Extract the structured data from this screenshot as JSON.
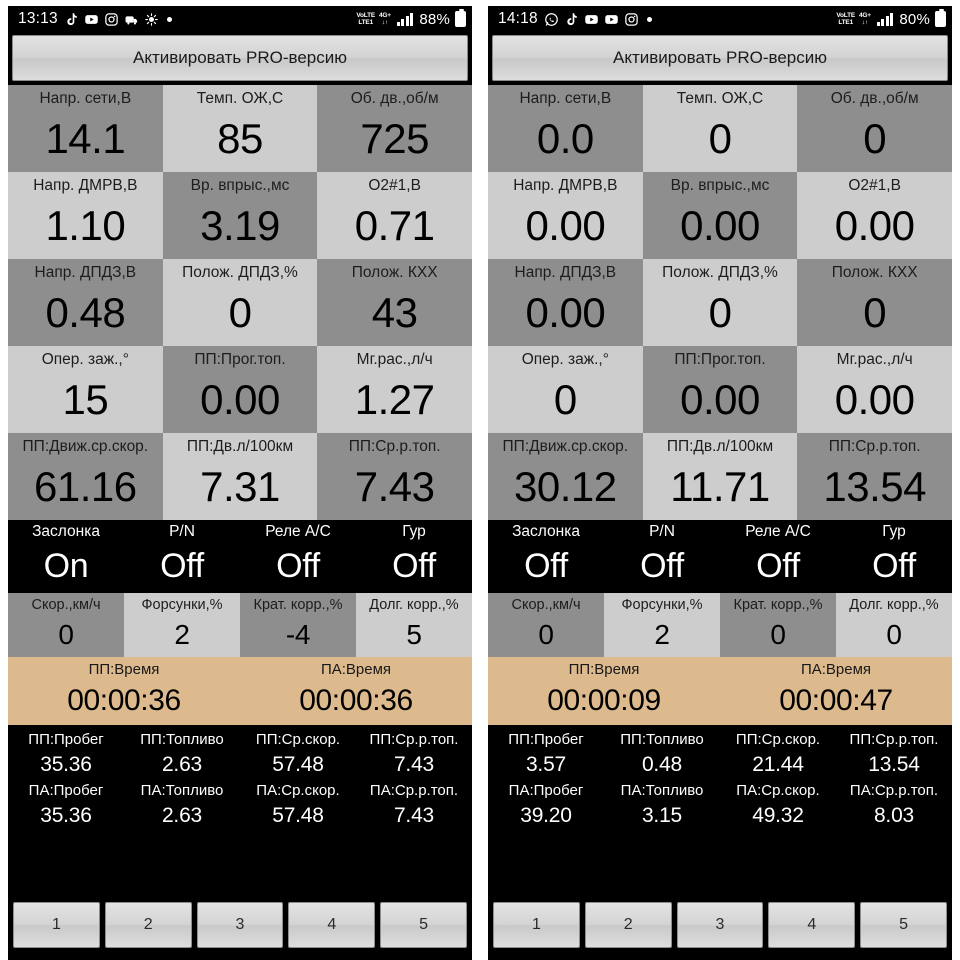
{
  "panels": [
    {
      "id": "left",
      "status": {
        "time": "13:13",
        "icons": [
          "tiktok-icon",
          "youtube-icon",
          "instagram-icon",
          "music-note-icon",
          "brightness-icon",
          "dot-icon"
        ],
        "volte_top": "VoLTE",
        "volte_bottom": "LTE1",
        "net_top": "4G+",
        "net_bottom": "↓↑",
        "battery": "88%"
      },
      "pro_button": "Активировать PRO-версию",
      "gauges": [
        {
          "label": "Напр. сети,В",
          "value": "14.1"
        },
        {
          "label": "Темп. ОЖ,С",
          "value": "85"
        },
        {
          "label": "Об. дв.,об/м",
          "value": "725"
        },
        {
          "label": "Напр. ДМРВ,В",
          "value": "1.10"
        },
        {
          "label": "Вр. впрыс.,мс",
          "value": "3.19"
        },
        {
          "label": "O2#1,В",
          "value": "0.71"
        },
        {
          "label": "Напр. ДПДЗ,В",
          "value": "0.48"
        },
        {
          "label": "Полож. ДПДЗ,%",
          "value": "0"
        },
        {
          "label": "Полож. КХХ",
          "value": "43"
        },
        {
          "label": "Опер. заж.,°",
          "value": "15"
        },
        {
          "label": "ПП:Прог.топ.",
          "value": "0.00"
        },
        {
          "label": "Мг.рас.,л/ч",
          "value": "1.27"
        },
        {
          "label": "ПП:Движ.ср.скор.",
          "value": "61.16"
        },
        {
          "label": "ПП:Дв.л/100км",
          "value": "7.31"
        },
        {
          "label": "ПП:Ср.р.топ.",
          "value": "7.43"
        }
      ],
      "switches": [
        {
          "label": "Заслонка",
          "value": "On"
        },
        {
          "label": "P/N",
          "value": "Off"
        },
        {
          "label": "Реле A/C",
          "value": "Off"
        },
        {
          "label": "Гур",
          "value": "Off"
        }
      ],
      "small": [
        {
          "label": "Скор.,км/ч",
          "value": "0"
        },
        {
          "label": "Форсунки,%",
          "value": "2"
        },
        {
          "label": "Крат. корр.,%",
          "value": "-4"
        },
        {
          "label": "Долг. корр.,%",
          "value": "5"
        }
      ],
      "times": [
        {
          "label": "ПП:Время",
          "value": "00:00:36"
        },
        {
          "label": "ПА:Время",
          "value": "00:00:36"
        }
      ],
      "trip": {
        "pp_labels": [
          "ПП:Пробег",
          "ПП:Топливо",
          "ПП:Ср.скор.",
          "ПП:Ср.р.топ."
        ],
        "pp_values": [
          "35.36",
          "2.63",
          "57.48",
          "7.43"
        ],
        "pa_labels": [
          "ПА:Пробег",
          "ПА:Топливо",
          "ПА:Ср.скор.",
          "ПА:Ср.р.топ."
        ],
        "pa_values": [
          "35.36",
          "2.63",
          "57.48",
          "7.43"
        ]
      },
      "buttons": [
        "1",
        "2",
        "3",
        "4",
        "5"
      ]
    },
    {
      "id": "right",
      "status": {
        "time": "14:18",
        "icons": [
          "whatsapp-icon",
          "tiktok-icon",
          "youtube-icon",
          "youtube-icon",
          "instagram-icon",
          "dot-icon"
        ],
        "volte_top": "VoLTE",
        "volte_bottom": "LTE1",
        "net_top": "4G+",
        "net_bottom": "↓↑",
        "battery": "80%"
      },
      "pro_button": "Активировать PRO-версию",
      "gauges": [
        {
          "label": "Напр. сети,В",
          "value": "0.0"
        },
        {
          "label": "Темп. ОЖ,С",
          "value": "0"
        },
        {
          "label": "Об. дв.,об/м",
          "value": "0"
        },
        {
          "label": "Напр. ДМРВ,В",
          "value": "0.00"
        },
        {
          "label": "Вр. впрыс.,мс",
          "value": "0.00"
        },
        {
          "label": "O2#1,В",
          "value": "0.00"
        },
        {
          "label": "Напр. ДПДЗ,В",
          "value": "0.00"
        },
        {
          "label": "Полож. ДПДЗ,%",
          "value": "0"
        },
        {
          "label": "Полож. КХХ",
          "value": "0"
        },
        {
          "label": "Опер. заж.,°",
          "value": "0"
        },
        {
          "label": "ПП:Прог.топ.",
          "value": "0.00"
        },
        {
          "label": "Мг.рас.,л/ч",
          "value": "0.00"
        },
        {
          "label": "ПП:Движ.ср.скор.",
          "value": "30.12"
        },
        {
          "label": "ПП:Дв.л/100км",
          "value": "11.71"
        },
        {
          "label": "ПП:Ср.р.топ.",
          "value": "13.54"
        }
      ],
      "switches": [
        {
          "label": "Заслонка",
          "value": "Off"
        },
        {
          "label": "P/N",
          "value": "Off"
        },
        {
          "label": "Реле A/C",
          "value": "Off"
        },
        {
          "label": "Гур",
          "value": "Off"
        }
      ],
      "small": [
        {
          "label": "Скор.,км/ч",
          "value": "0"
        },
        {
          "label": "Форсунки,%",
          "value": "2"
        },
        {
          "label": "Крат. корр.,%",
          "value": "0"
        },
        {
          "label": "Долг. корр.,%",
          "value": "0"
        }
      ],
      "times": [
        {
          "label": "ПП:Время",
          "value": "00:00:09"
        },
        {
          "label": "ПА:Время",
          "value": "00:00:47"
        }
      ],
      "trip": {
        "pp_labels": [
          "ПП:Пробег",
          "ПП:Топливо",
          "ПП:Ср.скор.",
          "ПП:Ср.р.топ."
        ],
        "pp_values": [
          "3.57",
          "0.48",
          "21.44",
          "13.54"
        ],
        "pa_labels": [
          "ПА:Пробег",
          "ПА:Топливо",
          "ПА:Ср.скор.",
          "ПА:Ср.р.топ."
        ],
        "pa_values": [
          "39.20",
          "3.15",
          "49.32",
          "8.03"
        ]
      },
      "buttons": [
        "1",
        "2",
        "3",
        "4",
        "5"
      ]
    }
  ],
  "colors": {
    "cell_dark": "#8e8e8e",
    "cell_light": "#cdcdcd",
    "time_strip": "#dcba8e",
    "black": "#000000"
  }
}
